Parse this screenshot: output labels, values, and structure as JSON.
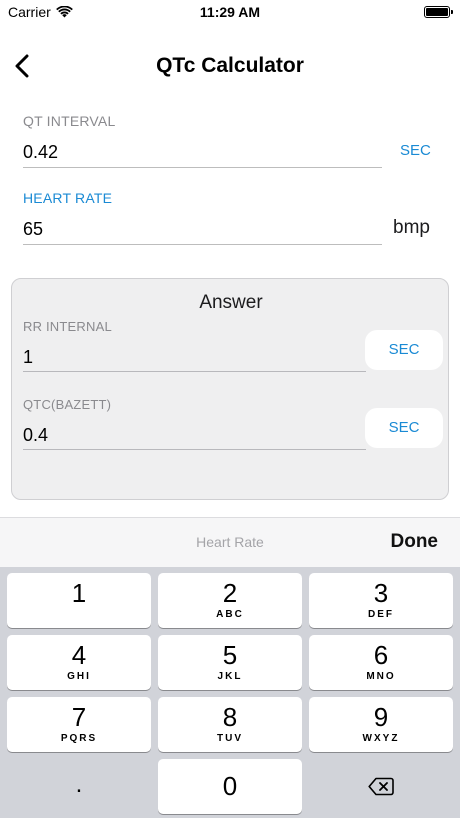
{
  "status": {
    "carrier": "Carrier",
    "time": "11:29 AM"
  },
  "nav": {
    "title": "QTc Calculator"
  },
  "qt": {
    "label": "QT INTERVAL",
    "value": "0.42",
    "unit": "SEC"
  },
  "heart_rate": {
    "label": "HEART RATE",
    "value": "65",
    "unit": "bmp"
  },
  "answer": {
    "title": "Answer",
    "rr": {
      "label": "RR INTERNAL",
      "value": "1",
      "unit": "SEC"
    },
    "qtc": {
      "label": "QTC(BAZETT)",
      "value": "0.4",
      "unit": "SEC"
    }
  },
  "accessory": {
    "placeholder": "Heart Rate",
    "done": "Done"
  },
  "keys": [
    {
      "num": "1",
      "letters": ""
    },
    {
      "num": "2",
      "letters": "ABC"
    },
    {
      "num": "3",
      "letters": "DEF"
    },
    {
      "num": "4",
      "letters": "GHI"
    },
    {
      "num": "5",
      "letters": "JKL"
    },
    {
      "num": "6",
      "letters": "MNO"
    },
    {
      "num": "7",
      "letters": "PQRS"
    },
    {
      "num": "8",
      "letters": "TUV"
    },
    {
      "num": "9",
      "letters": "WXYZ"
    },
    {
      "num": "0",
      "letters": ""
    }
  ],
  "decimal_key": ".",
  "colors": {
    "accent": "#1a8ad4",
    "keyboard_bg": "#d1d3d9",
    "card_bg": "#efeff0"
  }
}
